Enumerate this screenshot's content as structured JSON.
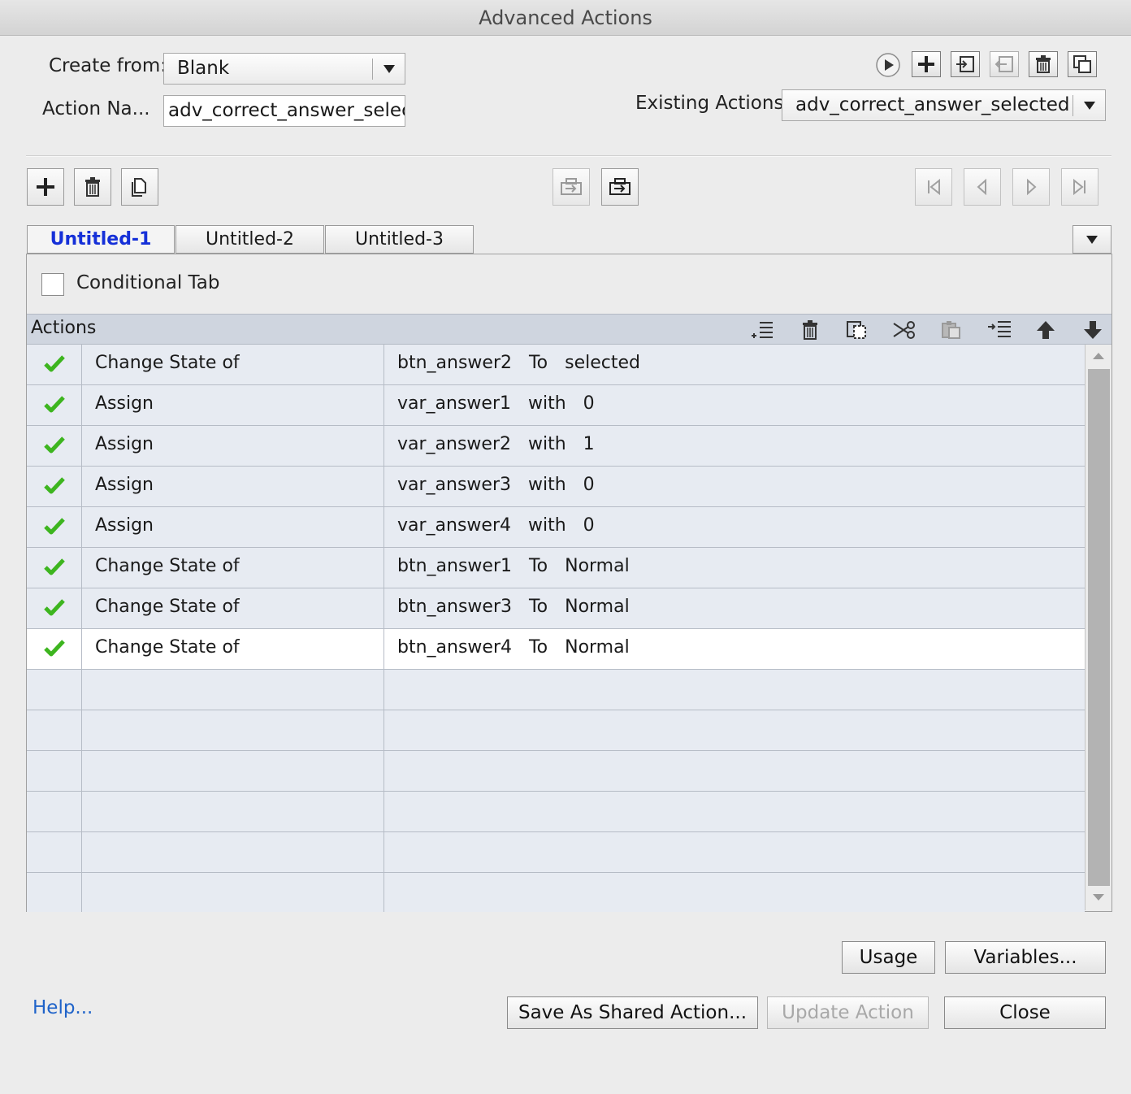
{
  "window": {
    "title": "Advanced Actions"
  },
  "form": {
    "create_from_label": "Create from:",
    "create_from_value": "Blank",
    "action_name_label": "Action Na...",
    "action_name_value": "adv_correct_answer_selected",
    "existing_actions_label": "Existing Actions:",
    "existing_actions_value": "adv_correct_answer_selected"
  },
  "tabs": [
    {
      "label": "Untitled-1",
      "active": true
    },
    {
      "label": "Untitled-2",
      "active": false
    },
    {
      "label": "Untitled-3",
      "active": false
    }
  ],
  "conditional_tab": {
    "label": "Conditional Tab",
    "checked": false
  },
  "actions_panel": {
    "header": "Actions"
  },
  "actions": [
    {
      "action": "Change State of",
      "target": "btn_answer2   To   selected"
    },
    {
      "action": "Assign",
      "target": "var_answer1   with   0"
    },
    {
      "action": "Assign",
      "target": "var_answer2   with   1"
    },
    {
      "action": "Assign",
      "target": "var_answer3   with   0"
    },
    {
      "action": "Assign",
      "target": "var_answer4   with   0"
    },
    {
      "action": "Change State of",
      "target": "btn_answer1   To   Normal"
    },
    {
      "action": "Change State of",
      "target": "btn_answer3   To   Normal"
    },
    {
      "action": "Change State of",
      "target": "btn_answer4   To   Normal"
    }
  ],
  "empty_rows": 6,
  "buttons": {
    "usage": "Usage",
    "variables": "Variables...",
    "help": "Help...",
    "save_shared": "Save As Shared Action...",
    "update": "Update Action",
    "close": "Close"
  },
  "colors": {
    "check_green": "#3db51f",
    "active_tab_text": "#1530d8",
    "help_link": "#1f63c9",
    "selected_row": "#ffffff",
    "row_bg": "#e7ebf2"
  }
}
